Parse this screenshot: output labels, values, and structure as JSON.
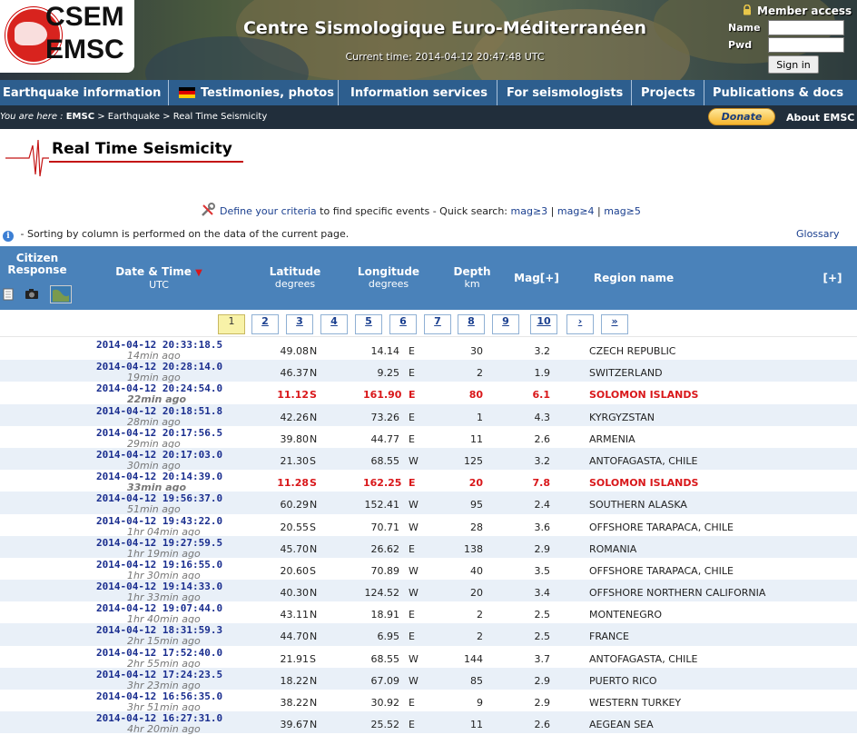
{
  "header": {
    "logo_top": "CSEM",
    "logo_bottom": "EMSC",
    "title": "Centre Sismologique Euro-Méditerranéen",
    "current_time": "Current time: 2014-04-12 20:47:48 UTC",
    "member": {
      "title": "Member access",
      "name_label": "Name",
      "pwd_label": "Pwd",
      "signin": "Sign in"
    }
  },
  "nav": [
    "Earthquake information",
    "Testimonies, photos",
    "Information services",
    "For seismologists",
    "Projects",
    "Publications & docs"
  ],
  "breadcrumb": {
    "prefix": "You are here :",
    "emsc": "EMSC",
    "rest": " > Earthquake > Real Time Seismicity"
  },
  "donate": "Donate",
  "about": "About EMSC",
  "page_title": "Real Time Seismicity",
  "criteria": {
    "link": "Define your criteria",
    "text": " to find specific events - Quick search: ",
    "q1": "mag≥3",
    "sep1": " | ",
    "q2": "mag≥4",
    "sep2": " | ",
    "q3": "mag≥5"
  },
  "sort_note": " - Sorting by column is performed on the data of the current page.",
  "glossary": "Glossary",
  "columns": {
    "citizen": "Citizen Response",
    "date": "Date & Time",
    "date_unit": "UTC",
    "lat": "Latitude",
    "lat_unit": "degrees",
    "lon": "Longitude",
    "lon_unit": "degrees",
    "depth": "Depth",
    "depth_unit": "km",
    "mag": "Mag[+]",
    "region": "Region name",
    "more": "[+]"
  },
  "pager": [
    "1",
    "2",
    "3",
    "4",
    "5",
    "6",
    "7",
    "8",
    "9",
    "10",
    "›",
    "»"
  ],
  "rows": [
    {
      "date": "2014-04-12  20:33:18.5",
      "ago": "14min ago",
      "lat": "49.08",
      "ns": "N",
      "lon": "14.14",
      "ew": "E",
      "depth": "30",
      "mag": "3.2",
      "region": "CZECH REPUBLIC"
    },
    {
      "date": "2014-04-12  20:28:14.0",
      "ago": "19min ago",
      "lat": "46.37",
      "ns": "N",
      "lon": "9.25",
      "ew": "E",
      "depth": "2",
      "mag": "1.9",
      "region": "SWITZERLAND"
    },
    {
      "date": "2014-04-12  20:24:54.0",
      "ago": "22min ago",
      "lat": "11.12",
      "ns": "S",
      "lon": "161.90",
      "ew": "E",
      "depth": "80",
      "mag": "6.1",
      "region": "SOLOMON ISLANDS",
      "big": true
    },
    {
      "date": "2014-04-12  20:18:51.8",
      "ago": "28min ago",
      "lat": "42.26",
      "ns": "N",
      "lon": "73.26",
      "ew": "E",
      "depth": "1",
      "mag": "4.3",
      "region": "KYRGYZSTAN"
    },
    {
      "date": "2014-04-12  20:17:56.5",
      "ago": "29min ago",
      "lat": "39.80",
      "ns": "N",
      "lon": "44.77",
      "ew": "E",
      "depth": "11",
      "mag": "2.6",
      "region": "ARMENIA"
    },
    {
      "date": "2014-04-12  20:17:03.0",
      "ago": "30min ago",
      "lat": "21.30",
      "ns": "S",
      "lon": "68.55",
      "ew": "W",
      "depth": "125",
      "mag": "3.2",
      "region": "ANTOFAGASTA, CHILE"
    },
    {
      "date": "2014-04-12  20:14:39.0",
      "ago": "33min ago",
      "lat": "11.28",
      "ns": "S",
      "lon": "162.25",
      "ew": "E",
      "depth": "20",
      "mag": "7.8",
      "region": "SOLOMON ISLANDS",
      "big": true
    },
    {
      "date": "2014-04-12  19:56:37.0",
      "ago": "51min ago",
      "lat": "60.29",
      "ns": "N",
      "lon": "152.41",
      "ew": "W",
      "depth": "95",
      "mag": "2.4",
      "region": "SOUTHERN ALASKA"
    },
    {
      "date": "2014-04-12  19:43:22.0",
      "ago": "1hr 04min ago",
      "lat": "20.55",
      "ns": "S",
      "lon": "70.71",
      "ew": "W",
      "depth": "28",
      "mag": "3.6",
      "region": "OFFSHORE TARAPACA, CHILE"
    },
    {
      "date": "2014-04-12  19:27:59.5",
      "ago": "1hr 19min ago",
      "lat": "45.70",
      "ns": "N",
      "lon": "26.62",
      "ew": "E",
      "depth": "138",
      "mag": "2.9",
      "region": "ROMANIA"
    },
    {
      "date": "2014-04-12  19:16:55.0",
      "ago": "1hr 30min ago",
      "lat": "20.60",
      "ns": "S",
      "lon": "70.89",
      "ew": "W",
      "depth": "40",
      "mag": "3.5",
      "region": "OFFSHORE TARAPACA, CHILE"
    },
    {
      "date": "2014-04-12  19:14:33.0",
      "ago": "1hr 33min ago",
      "lat": "40.30",
      "ns": "N",
      "lon": "124.52",
      "ew": "W",
      "depth": "20",
      "mag": "3.4",
      "region": "OFFSHORE NORTHERN CALIFORNIA"
    },
    {
      "date": "2014-04-12  19:07:44.0",
      "ago": "1hr 40min ago",
      "lat": "43.11",
      "ns": "N",
      "lon": "18.91",
      "ew": "E",
      "depth": "2",
      "mag": "2.5",
      "region": "MONTENEGRO"
    },
    {
      "date": "2014-04-12  18:31:59.3",
      "ago": "2hr 15min ago",
      "lat": "44.70",
      "ns": "N",
      "lon": "6.95",
      "ew": "E",
      "depth": "2",
      "mag": "2.5",
      "region": "FRANCE"
    },
    {
      "date": "2014-04-12  17:52:40.0",
      "ago": "2hr 55min ago",
      "lat": "21.91",
      "ns": "S",
      "lon": "68.55",
      "ew": "W",
      "depth": "144",
      "mag": "3.7",
      "region": "ANTOFAGASTA, CHILE"
    },
    {
      "date": "2014-04-12  17:24:23.5",
      "ago": "3hr 23min ago",
      "lat": "18.22",
      "ns": "N",
      "lon": "67.09",
      "ew": "W",
      "depth": "85",
      "mag": "2.9",
      "region": "PUERTO RICO"
    },
    {
      "date": "2014-04-12  16:56:35.0",
      "ago": "3hr 51min ago",
      "lat": "38.22",
      "ns": "N",
      "lon": "30.92",
      "ew": "E",
      "depth": "9",
      "mag": "2.9",
      "region": "WESTERN TURKEY"
    },
    {
      "date": "2014-04-12  16:27:31.0",
      "ago": "4hr 20min ago",
      "lat": "39.67",
      "ns": "N",
      "lon": "25.52",
      "ew": "E",
      "depth": "11",
      "mag": "2.6",
      "region": "AEGEAN SEA"
    }
  ]
}
